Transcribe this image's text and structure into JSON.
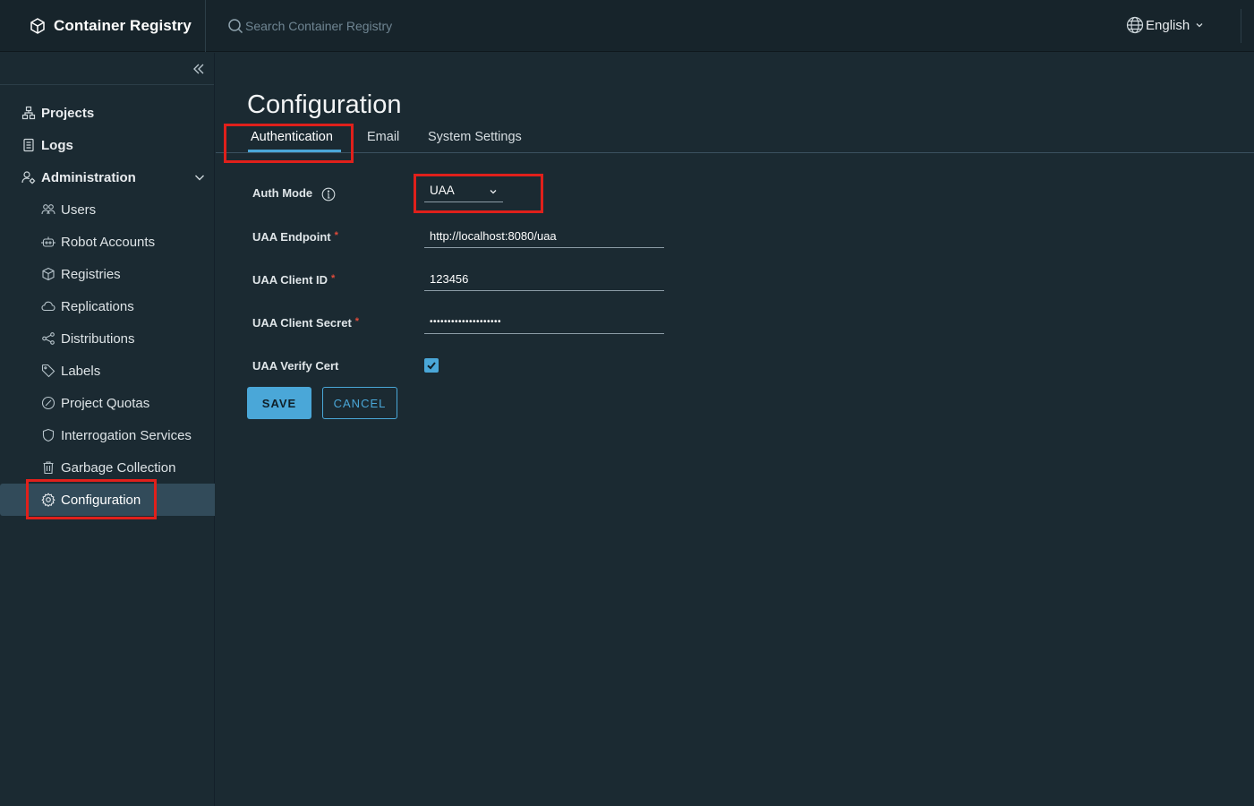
{
  "header": {
    "app_title": "Container Registry",
    "search_placeholder": "Search Container Registry",
    "language": "English"
  },
  "sidebar": {
    "items": [
      {
        "label": "Projects"
      },
      {
        "label": "Logs"
      },
      {
        "label": "Administration"
      }
    ],
    "admin_items": [
      {
        "label": "Users"
      },
      {
        "label": "Robot Accounts"
      },
      {
        "label": "Registries"
      },
      {
        "label": "Replications"
      },
      {
        "label": "Distributions"
      },
      {
        "label": "Labels"
      },
      {
        "label": "Project Quotas"
      },
      {
        "label": "Interrogation Services"
      },
      {
        "label": "Garbage Collection"
      },
      {
        "label": "Configuration"
      }
    ],
    "active_item": "Configuration"
  },
  "main": {
    "title": "Configuration",
    "tabs": [
      {
        "label": "Authentication",
        "active": true
      },
      {
        "label": "Email",
        "active": false
      },
      {
        "label": "System Settings",
        "active": false
      }
    ],
    "form": {
      "auth_mode_label": "Auth Mode",
      "auth_mode_value": "UAA",
      "uaa_endpoint_label": "UAA Endpoint",
      "uaa_endpoint_value": "http://localhost:8080/uaa",
      "uaa_client_id_label": "UAA Client ID",
      "uaa_client_id_value": "123456",
      "uaa_client_secret_label": "UAA Client Secret",
      "uaa_client_secret_value": "••••••••••••••••••••",
      "uaa_verify_cert_label": "UAA Verify Cert",
      "uaa_verify_cert_checked": true,
      "required_marker": "*"
    },
    "buttons": {
      "save": "SAVE",
      "cancel": "CANCEL"
    }
  },
  "colors": {
    "accent": "#4aa7d8",
    "highlight": "#e0201b",
    "required": "#e14b3b"
  }
}
